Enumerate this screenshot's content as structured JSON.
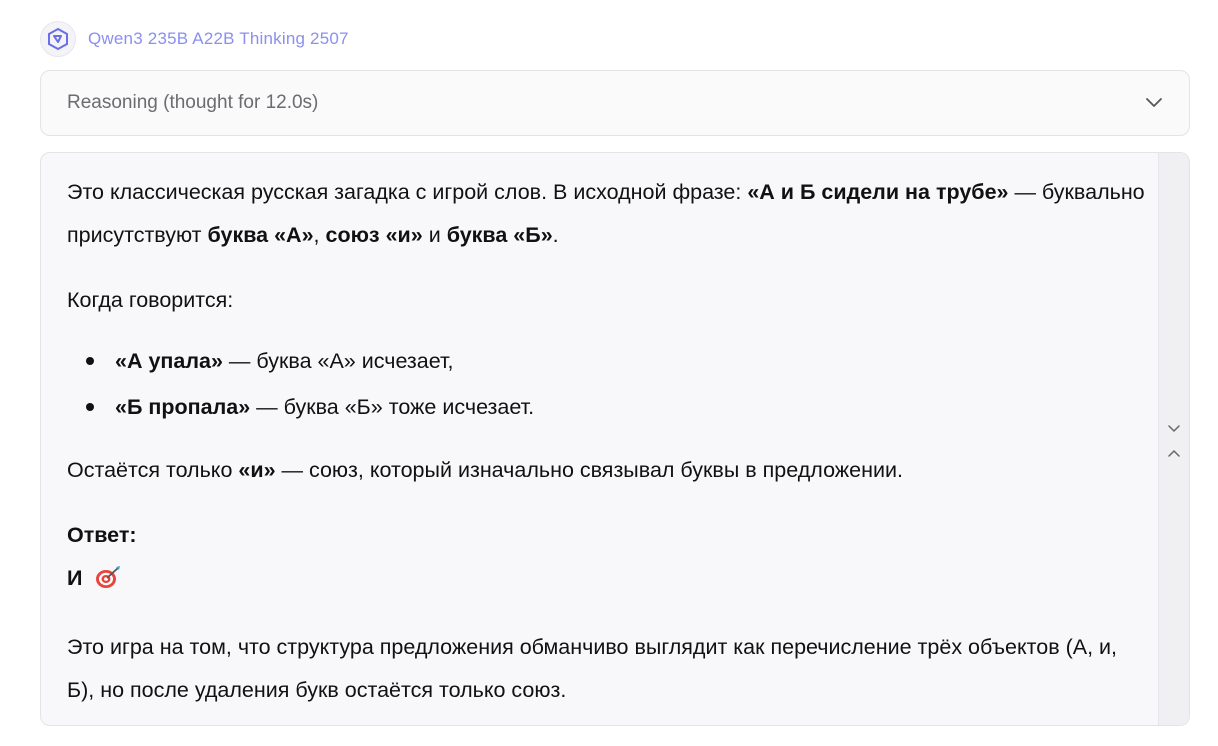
{
  "header": {
    "model_name": "Qwen3 235B A22B Thinking 2507",
    "logo_icon": "qwen-logo-icon"
  },
  "reasoning": {
    "label": "Reasoning (thought for 12.0s)",
    "toggle_icon": "chevron-down-icon"
  },
  "answer": {
    "p1_a": "Это классическая русская загадка с игрой слов. В исходной фразе: ",
    "p1_b": "«А и Б сидели на трубе»",
    "p1_c": " — буквально присутствуют ",
    "p1_d": "буква «А»",
    "p1_e": ", ",
    "p1_f": "союз «и»",
    "p1_g": " и ",
    "p1_h": "буква «Б»",
    "p1_i": ".",
    "p2": "Когда говорится:",
    "bullets": [
      {
        "bold": "«А упала»",
        "text": " — буква «А» исчезает,"
      },
      {
        "bold": "«Б пропала»",
        "text": " — буква «Б» тоже исчезает."
      }
    ],
    "p3_a": "Остаётся только ",
    "p3_b": "«и»",
    "p3_c": " — союз, который изначально связывал буквы в предложении.",
    "answer_label": "Ответ:",
    "answer_value": "И",
    "answer_icon": "target-icon",
    "p4": "Это игра на том, что структура предложения обманчиво выглядит как перечисление трёх объектов (А, и, Б), но после удаления букв остаётся только союз."
  },
  "scrollbar": {
    "down_icon": "chevron-down-icon",
    "up_icon": "chevron-up-icon"
  }
}
